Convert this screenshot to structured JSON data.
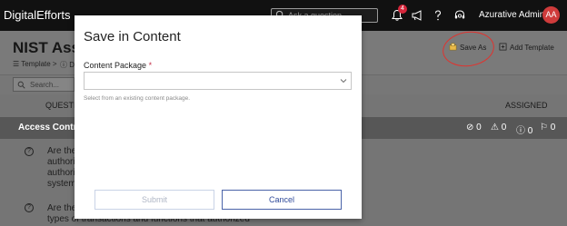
{
  "topbar": {
    "brand": "DigitalEfforts",
    "search_placeholder": "Ask a question...",
    "notification_count": "4",
    "user_name": "Azurative Admin",
    "avatar_initials": "AA"
  },
  "page": {
    "title": "NIST Asse",
    "breadcrumb_1": "Template >",
    "breadcrumb_2": "D",
    "save_as_label": "Save As",
    "add_template_label": "Add Template",
    "filter_placeholder": "Search...",
    "col_question": "QUESTI",
    "col_assigned": "ASSIGNED",
    "group_title": "Access Control",
    "stats": [
      "0",
      "0",
      "0",
      "0"
    ],
    "questions": [
      {
        "lines": [
          "Are the",
          "authoriz",
          "authoriz",
          "systems"
        ]
      },
      {
        "lines": [
          "Are ther",
          "types of transactions and functions that authorized"
        ]
      }
    ]
  },
  "modal": {
    "title": "Save in Content",
    "field_label": "Content Package",
    "required_mark": "*",
    "helper_text": "Select from an existing content package.",
    "submit_label": "Submit",
    "cancel_label": "Cancel"
  },
  "colors": {
    "accent": "#2f4a9a",
    "annotation": "#e0332f",
    "avatar": "#cf3b3b"
  }
}
